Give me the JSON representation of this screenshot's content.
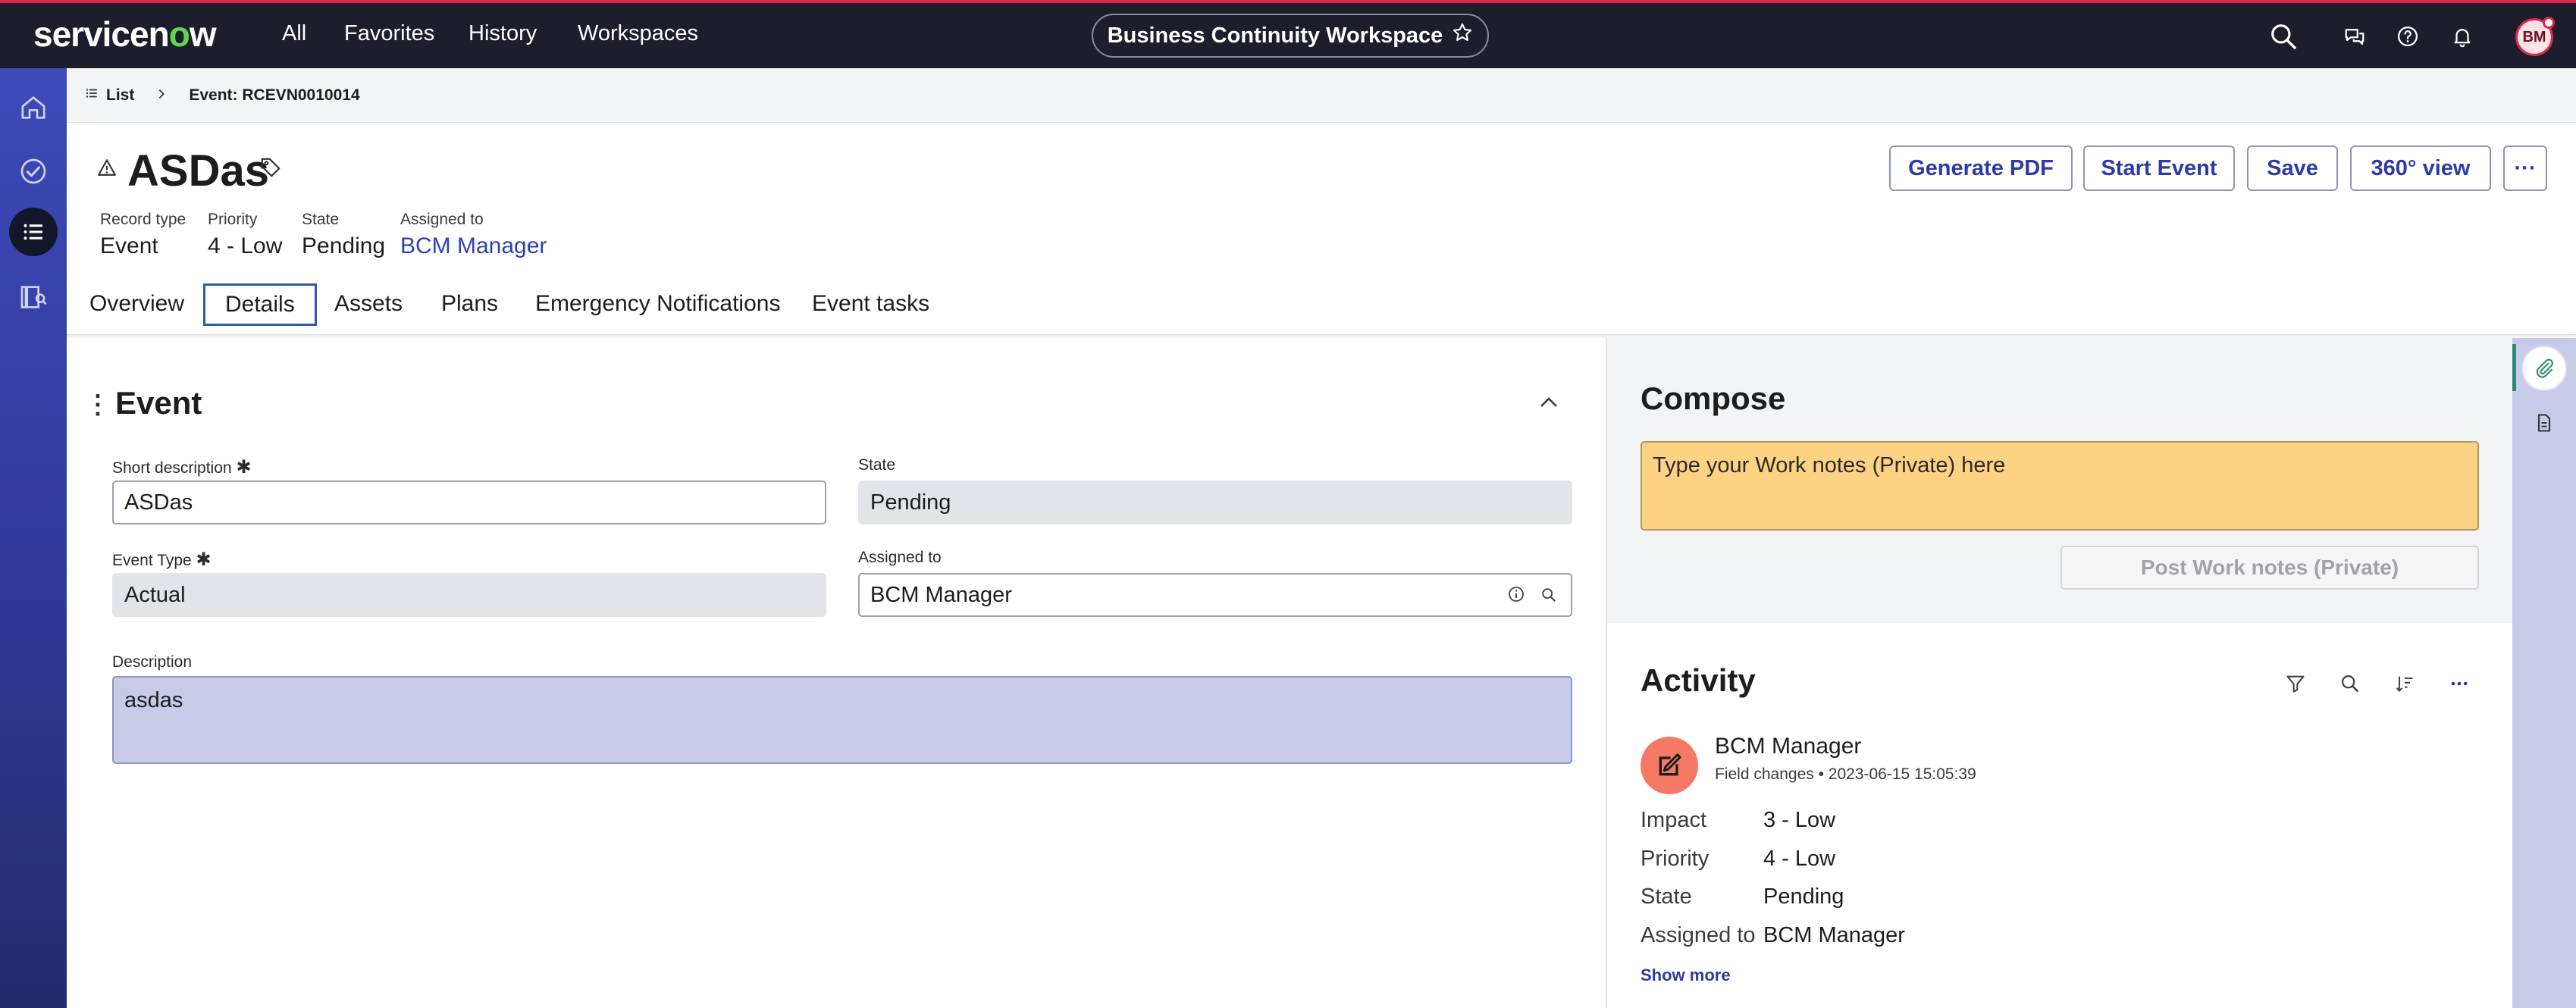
{
  "top_nav": {
    "logo_service": "servicen",
    "logo_o": "o",
    "logo_w": "w",
    "items": [
      "All",
      "Favorites",
      "History",
      "Workspaces"
    ],
    "workspace": "Business Continuity Workspace",
    "avatar_initials": "BM"
  },
  "breadcrumb": {
    "list_label": "List",
    "current": "Event: RCEVN0010014"
  },
  "record": {
    "title": "ASDas",
    "meta": [
      {
        "label": "Record type",
        "value": "Event"
      },
      {
        "label": "Priority",
        "value": "4 - Low"
      },
      {
        "label": "State",
        "value": "Pending"
      },
      {
        "label": "Assigned to",
        "value": "BCM Manager"
      }
    ],
    "buttons": {
      "generate_pdf": "Generate PDF",
      "start_event": "Start Event",
      "save": "Save",
      "view360": "360° view",
      "more": "···"
    },
    "tabs": [
      "Overview",
      "Details",
      "Assets",
      "Plans",
      "Emergency Notifications",
      "Event tasks"
    ],
    "active_tab": "Details"
  },
  "form": {
    "section_title": "Event",
    "short_description": {
      "label": "Short description",
      "required": "✱",
      "value": "ASDas"
    },
    "state": {
      "label": "State",
      "value": "Pending"
    },
    "event_type": {
      "label": "Event Type",
      "required": "✱",
      "value": "Actual"
    },
    "assigned_to": {
      "label": "Assigned to",
      "value": "BCM Manager"
    },
    "description": {
      "label": "Description",
      "value": "asdas"
    }
  },
  "compose": {
    "title": "Compose",
    "placeholder": "Type your Work notes (Private) here",
    "post_button": "Post Work notes (Private)"
  },
  "activity": {
    "title": "Activity",
    "entry": {
      "user": "BCM Manager",
      "type": "Field changes",
      "separator": "•",
      "timestamp": "2023-06-15 15:05:39",
      "fields": [
        {
          "name": "Impact",
          "value": "3 - Low"
        },
        {
          "name": "Priority",
          "value": "4 - Low"
        },
        {
          "name": "State",
          "value": "Pending"
        },
        {
          "name": "Assigned to",
          "value": "BCM Manager"
        }
      ]
    },
    "show_more": "Show more"
  },
  "colors": {
    "nav_bg": "#1c1e2b",
    "accent_red": "#e0264b",
    "brand_green": "#62d84e",
    "link_blue": "#2f3fb6",
    "compose_yellow": "#fdd283",
    "description_bg": "#c8cbe8"
  }
}
